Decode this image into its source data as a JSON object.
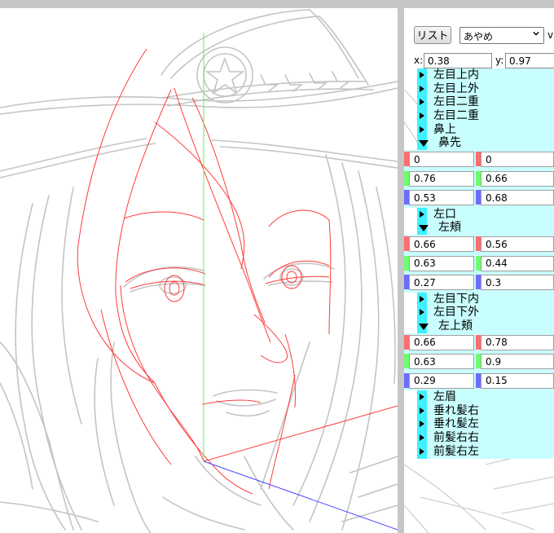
{
  "toolbar": {
    "list_button": "リスト",
    "character_select": "あやめ",
    "truncated_label": "v"
  },
  "coords": {
    "x_label": "x:",
    "x_value": "0.38",
    "y_label": "y:",
    "y_value": "0.97"
  },
  "tree": {
    "part1": [
      "左目上内",
      "左目上外",
      "左目二重",
      "左目二重",
      "鼻上"
    ],
    "nose_tip": {
      "label": "鼻先",
      "rows": [
        {
          "a": "0",
          "b": "0"
        },
        {
          "a": "0.76",
          "b": "0.66"
        },
        {
          "a": "0.53",
          "b": "0.68"
        }
      ]
    },
    "part2": [
      "左口"
    ],
    "left_cheek": {
      "label": "左頬",
      "rows": [
        {
          "a": "0.66",
          "b": "0.56"
        },
        {
          "a": "0.63",
          "b": "0.44"
        },
        {
          "a": "0.27",
          "b": "0.3"
        }
      ]
    },
    "part3": [
      "左目下内",
      "左目下外"
    ],
    "upper_cheek": {
      "label": "左上頬",
      "rows": [
        {
          "a": "0.66",
          "b": "0.78"
        },
        {
          "a": "0.63",
          "b": "0.9"
        },
        {
          "a": "0.29",
          "b": "0.15"
        }
      ]
    },
    "part4": [
      "左眉",
      "垂れ髪右",
      "垂れ髪左",
      "前髪右右",
      "前髪右左"
    ]
  },
  "colors": {
    "tree_bg": "#c9feff",
    "tree_bar": "#3ff1ff",
    "x_channel": "#ff6d6d",
    "y_channel": "#6dff6d",
    "z_channel": "#6d6dff",
    "guide_red": "#ff3b3b",
    "guide_green": "#5ef25e",
    "guide_blue": "#4a4aff",
    "sketch": "#c4c4c4"
  },
  "icons": {
    "collapsed": "triangle-right-icon",
    "expanded": "triangle-down-icon",
    "select": "chevron-down-icon"
  }
}
